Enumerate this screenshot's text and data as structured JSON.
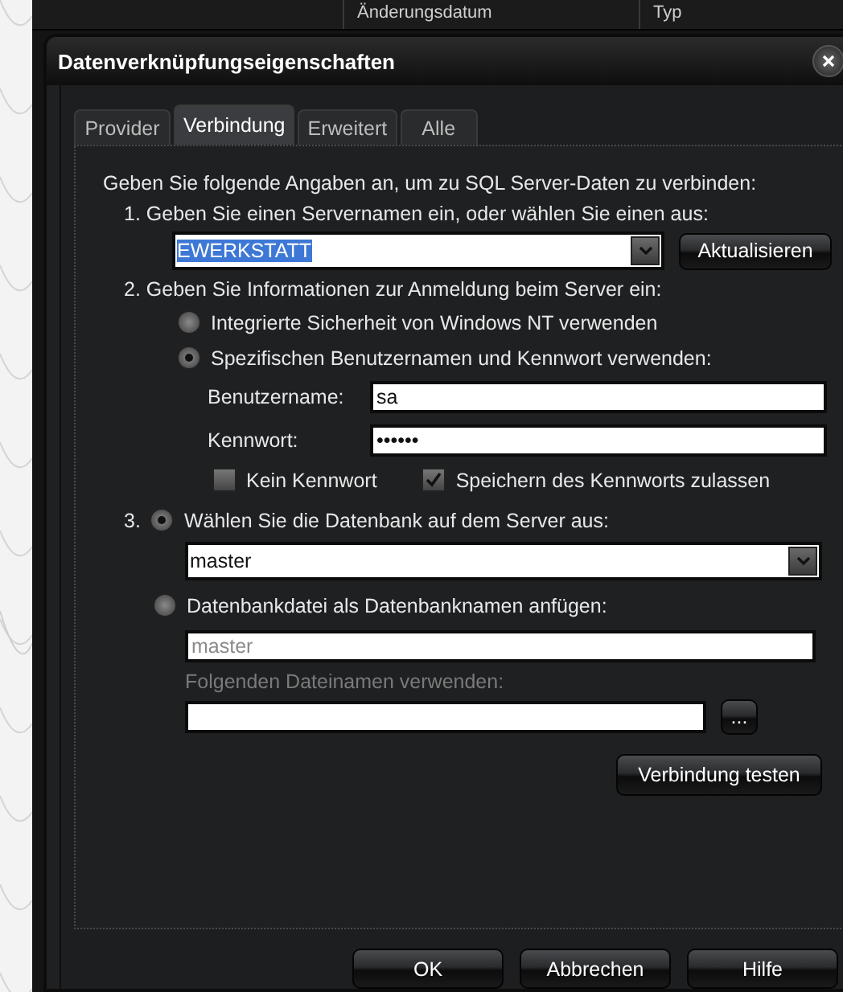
{
  "background_app": {
    "columns": [
      "Änderungsdatum",
      "Typ"
    ]
  },
  "dialog": {
    "title": "Datenverknüpfungseigenschaften",
    "tabs": [
      {
        "label": "Provider",
        "selected": false
      },
      {
        "label": "Verbindung",
        "selected": true
      },
      {
        "label": "Erweitert",
        "selected": false
      },
      {
        "label": "Alle",
        "selected": false
      }
    ],
    "intro": "Geben Sie folgende Angaben an, um zu SQL Server-Daten zu verbinden:",
    "step1": {
      "label": "1. Geben Sie einen Servernamen ein, oder wählen Sie einen aus:",
      "server": {
        "value": "EWERKSTATT",
        "text_selected": true
      },
      "refresh_button": "Aktualisieren"
    },
    "step2": {
      "label": "2. Geben Sie Informationen zur Anmeldung beim Server ein:",
      "auth_options": [
        {
          "label": "Integrierte Sicherheit von Windows NT verwenden",
          "selected": false
        },
        {
          "label": "Spezifischen Benutzernamen und Kennwort verwenden:",
          "selected": true
        }
      ],
      "username": {
        "label": "Benutzername:",
        "value": "sa"
      },
      "password": {
        "label": "Kennwort:",
        "value": "••••••"
      },
      "checkboxes": [
        {
          "label": "Kein Kennwort",
          "checked": false
        },
        {
          "label": "Speichern des Kennworts zulassen",
          "checked": true
        }
      ]
    },
    "step3": {
      "number": "3.",
      "database_option": {
        "label": "Wählen Sie die Datenbank auf dem Server aus:",
        "selected": true
      },
      "database": {
        "value": "master"
      },
      "file_option": {
        "label": "Datenbankdatei als Datenbanknamen anfügen:",
        "selected": false
      },
      "file_database_name": {
        "value": "master",
        "disabled": true
      },
      "file_name_label": {
        "text": "Folgenden Dateinamen verwenden:",
        "disabled": true
      },
      "browse_button": "...",
      "test_button": "Verbindung testen"
    },
    "buttons": [
      "OK",
      "Abbrechen",
      "Hilfe"
    ]
  }
}
